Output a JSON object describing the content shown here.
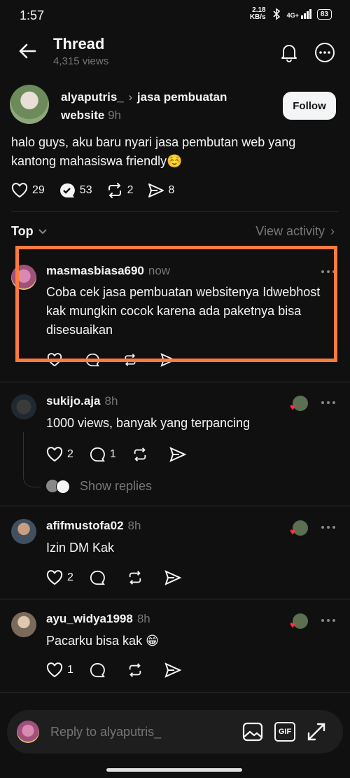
{
  "status": {
    "time": "1:57",
    "net_speed": "2.18",
    "net_unit": "KB/s",
    "signal": "4G+",
    "battery": "83"
  },
  "header": {
    "title": "Thread",
    "views": "4,315 views"
  },
  "post": {
    "username": "alyaputris_",
    "community": "jasa pembuatan",
    "community_cont": "website",
    "time": "9h",
    "follow_label": "Follow",
    "text": "halo guys, aku baru nyari jasa pembutan web yang kantong mahasiswa friendly☺️",
    "likes": "29",
    "replies": "53",
    "reposts": "2",
    "shares": "8"
  },
  "sort": {
    "label": "Top",
    "view_activity": "View activity"
  },
  "comments": [
    {
      "username": "masmasbiasa690",
      "time": "now",
      "text": "Coba cek jasa pembuatan websitenya Idwebhost kak mungkin cocok karena ada paketnya bisa disesuaikan"
    },
    {
      "username": "sukijo.aja",
      "time": "8h",
      "text": "1000 views, banyak yang terpancing",
      "likes": "2",
      "replies": "1",
      "show_replies": "Show replies"
    },
    {
      "username": "afifmustofa02",
      "time": "8h",
      "text": "Izin DM Kak",
      "likes": "2"
    },
    {
      "username": "ayu_widya1998",
      "time": "8h",
      "text": "Pacarku bisa kak 😁",
      "likes": "1"
    }
  ],
  "reply_bar": {
    "placeholder": "Reply to alyaputris_",
    "gif_label": "GIF"
  },
  "colors": {
    "background": "#101010",
    "highlight": "#ff7a3d",
    "like_red": "#ff3040"
  }
}
